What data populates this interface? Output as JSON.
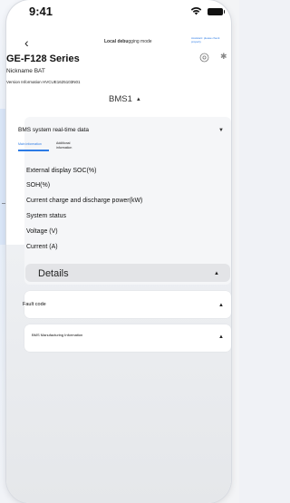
{
  "status_bar": {
    "time": "9:41"
  },
  "header": {
    "back_icon": "‹",
    "mode_bold": "Local debu",
    "mode_rest": "gging mode",
    "corner_note": "Assistant: please check properly",
    "title": "GE-F128 Series",
    "nickname": "Nickname BAT",
    "version": "Version Information HVCUE1625103N01",
    "bluetooth_icon": "✱"
  },
  "bms_selector": {
    "label": "BMS1",
    "arrow": "▲"
  },
  "realtime_card": {
    "title": "BMS system real-time data",
    "arrow": "▼",
    "tabs": [
      {
        "label": "Main information",
        "active": true
      },
      {
        "label": "Additional information",
        "active": false
      }
    ],
    "rows": [
      "External display SOC(%)",
      "SOH(%)",
      "Current charge and discharge power(kW)",
      "System status",
      "Voltage (V)",
      "Current (A)"
    ],
    "details": {
      "label": "Details",
      "arrow": "▲"
    }
  },
  "fault_card": {
    "title": "Fault code",
    "arrow": "▲"
  },
  "manufacturing_card": {
    "title": "BMS Manufacturing Information",
    "arrow": "▲"
  },
  "colors": {
    "accent": "#2c7be5",
    "card_bg": "#f5f6f8",
    "details_bg": "#e3e4e7"
  }
}
